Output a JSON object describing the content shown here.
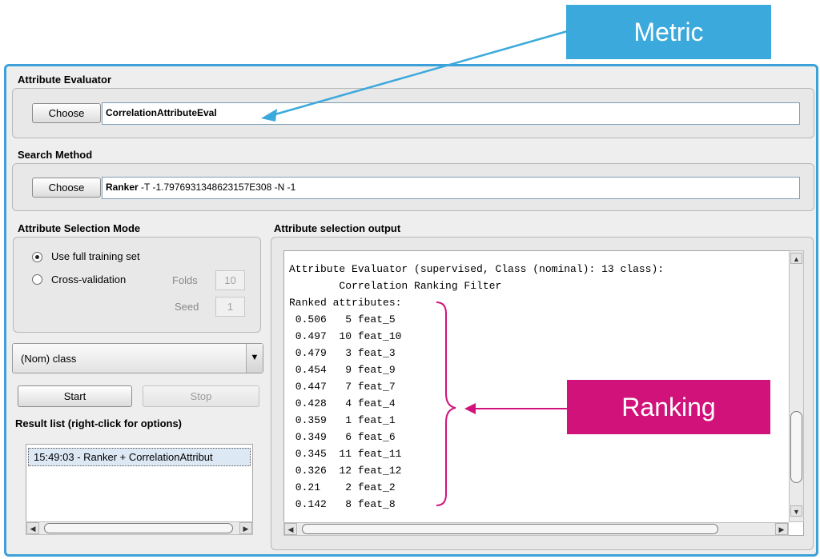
{
  "attribute_evaluator": {
    "label": "Attribute Evaluator",
    "choose_label": "Choose",
    "name": "CorrelationAttributeEval"
  },
  "search_method": {
    "label": "Search Method",
    "choose_label": "Choose",
    "name": "Ranker",
    "options": " -T -1.7976931348623157E308 -N -1"
  },
  "selection_mode": {
    "label": "Attribute Selection Mode",
    "full_training": "Use full training set",
    "cross_validation": "Cross-validation",
    "selected": "full_training",
    "folds_label": "Folds",
    "folds_value": "10",
    "seed_label": "Seed",
    "seed_value": "1"
  },
  "class_select": {
    "value": "(Nom) class"
  },
  "actions": {
    "start": "Start",
    "stop": "Stop"
  },
  "result_list": {
    "label": "Result list (right-click for options)",
    "items": [
      "15:49:03 - Ranker + CorrelationAttribut"
    ]
  },
  "output": {
    "label": "Attribute selection output",
    "lines": [
      "Attribute Evaluator (supervised, Class (nominal): 13 class):",
      "        Correlation Ranking Filter",
      "Ranked attributes:",
      " 0.506   5 feat_5",
      " 0.497  10 feat_10",
      " 0.479   3 feat_3",
      " 0.454   9 feat_9",
      " 0.447   7 feat_7",
      " 0.428   4 feat_4",
      " 0.359   1 feat_1",
      " 0.349   6 feat_6",
      " 0.345  11 feat_11",
      " 0.326  12 feat_12",
      " 0.21    2 feat_2",
      " 0.142   8 feat_8"
    ]
  },
  "annotations": {
    "metric_label": "Metric",
    "ranking_label": "Ranking",
    "metric_color": "#3ba9dc",
    "ranking_color": "#d1127a"
  }
}
